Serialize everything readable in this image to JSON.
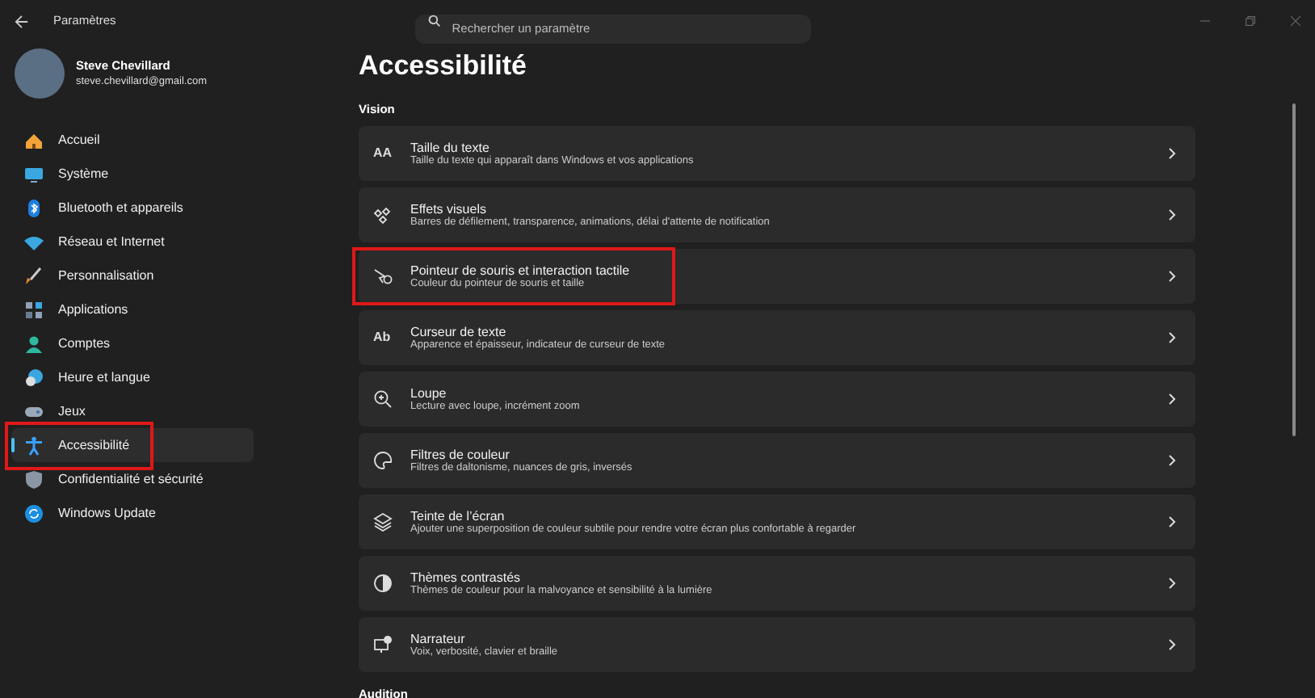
{
  "window": {
    "title": "Paramètres"
  },
  "search": {
    "placeholder": "Rechercher un paramètre"
  },
  "user": {
    "name": "Steve Chevillard",
    "email": "steve.chevillard@gmail.com"
  },
  "sidebar": {
    "items": [
      {
        "label": "Accueil",
        "kind": "home",
        "selected": false,
        "highlighted": false
      },
      {
        "label": "Système",
        "kind": "system",
        "selected": false,
        "highlighted": false
      },
      {
        "label": "Bluetooth et appareils",
        "kind": "bluetooth",
        "selected": false,
        "highlighted": false
      },
      {
        "label": "Réseau et Internet",
        "kind": "network",
        "selected": false,
        "highlighted": false
      },
      {
        "label": "Personnalisation",
        "kind": "brush",
        "selected": false,
        "highlighted": false
      },
      {
        "label": "Applications",
        "kind": "apps",
        "selected": false,
        "highlighted": false
      },
      {
        "label": "Comptes",
        "kind": "account",
        "selected": false,
        "highlighted": false
      },
      {
        "label": "Heure et langue",
        "kind": "time",
        "selected": false,
        "highlighted": false
      },
      {
        "label": "Jeux",
        "kind": "games",
        "selected": false,
        "highlighted": false
      },
      {
        "label": "Accessibilité",
        "kind": "accessibility",
        "selected": true,
        "highlighted": true
      },
      {
        "label": "Confidentialité et sécurité",
        "kind": "shield",
        "selected": false,
        "highlighted": false
      },
      {
        "label": "Windows Update",
        "kind": "update",
        "selected": false,
        "highlighted": false
      }
    ]
  },
  "page": {
    "title": "Accessibilité",
    "section": "Vision",
    "next_section": "Audition",
    "items": [
      {
        "title": "Taille du texte",
        "subtitle": "Taille du texte qui apparaît dans Windows et vos applications",
        "kind": "text-size",
        "icon_text": "AA",
        "highlighted": false
      },
      {
        "title": "Effets visuels",
        "subtitle": "Barres de défilement, transparence, animations, délai d'attente de notification",
        "kind": "effects",
        "highlighted": false
      },
      {
        "title": "Pointeur de souris et interaction tactile",
        "subtitle": "Couleur du pointeur de souris et taille",
        "kind": "pointer",
        "highlighted": true
      },
      {
        "title": "Curseur de texte",
        "subtitle": "Apparence et épaisseur, indicateur de curseur de texte",
        "kind": "cursor",
        "icon_text": "Ab",
        "highlighted": false
      },
      {
        "title": "Loupe",
        "subtitle": "Lecture avec loupe, incrément zoom",
        "kind": "magnifier",
        "highlighted": false
      },
      {
        "title": "Filtres de couleur",
        "subtitle": "Filtres de daltonisme, nuances de gris, inversés",
        "kind": "palette",
        "highlighted": false
      },
      {
        "title": "Teinte de l’écran",
        "subtitle": "Ajouter une superposition de couleur subtile pour rendre votre écran plus confortable à regarder",
        "kind": "layers",
        "highlighted": false
      },
      {
        "title": "Thèmes contrastés",
        "subtitle": "Thèmes de couleur pour la malvoyance et sensibilité à la lumière",
        "kind": "contrast",
        "highlighted": false
      },
      {
        "title": "Narrateur",
        "subtitle": "Voix, verbosité, clavier et braille",
        "kind": "narrator",
        "highlighted": false
      }
    ]
  }
}
